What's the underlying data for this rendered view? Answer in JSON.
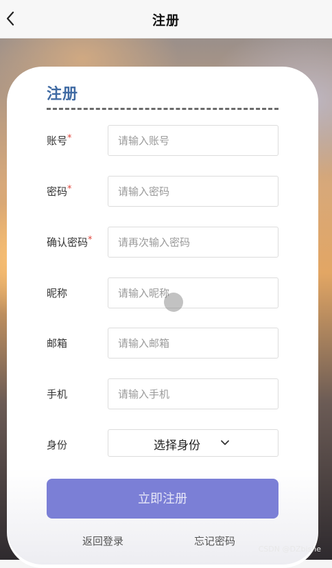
{
  "header": {
    "title": "注册",
    "back_icon": "chevron-left-icon"
  },
  "form": {
    "title": "注册",
    "fields": [
      {
        "label": "账号",
        "required": "*",
        "placeholder": "请输入账号"
      },
      {
        "label": "密码",
        "required": "*",
        "placeholder": "请输入密码"
      },
      {
        "label": "确认密码",
        "required": "*",
        "placeholder": "请再次输入密码"
      },
      {
        "label": "昵称",
        "required": "",
        "placeholder": "请输入昵称"
      },
      {
        "label": "邮箱",
        "required": "",
        "placeholder": "请输入邮箱"
      },
      {
        "label": "手机",
        "required": "",
        "placeholder": "请输入手机"
      }
    ],
    "role": {
      "label": "身份",
      "selected": "选择身份",
      "icon": "chevron-down-icon"
    },
    "submit_label": "立即注册",
    "back_login_label": "返回登录",
    "forgot_label": "忘记密码"
  },
  "watermark": "CSDN @DZbishe",
  "colors": {
    "title": "#3f6aa3",
    "button": "#7b7fd6",
    "required": "#e0443a"
  }
}
